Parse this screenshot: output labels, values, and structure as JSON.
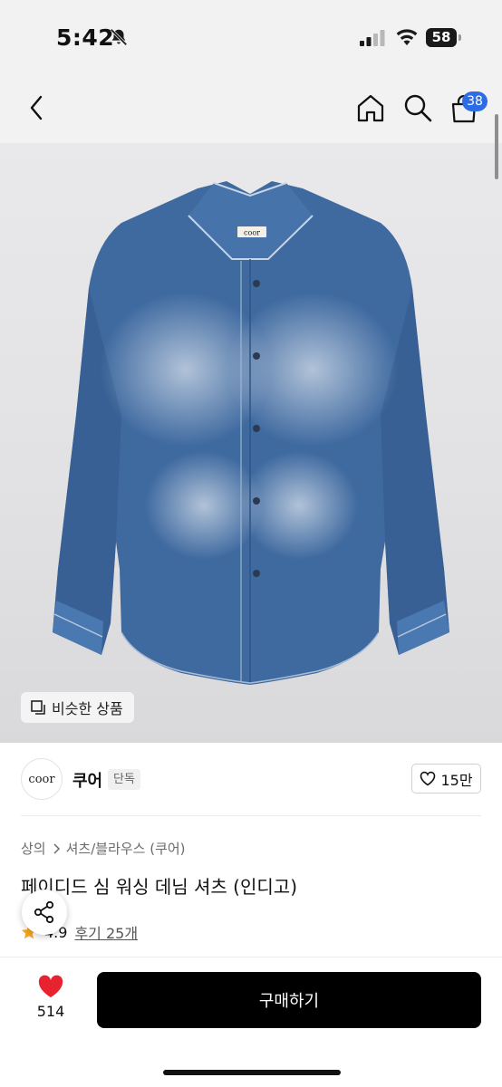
{
  "status_bar": {
    "time": "5:42",
    "battery": "58",
    "icons": [
      "bell-slash-icon",
      "cellular-signal-icon",
      "wifi-icon",
      "battery-icon"
    ]
  },
  "nav": {
    "cart_count": "38",
    "icons": [
      "chevron-left-icon",
      "home-icon",
      "search-icon",
      "shopping-bag-icon"
    ]
  },
  "product_image": {
    "similar_products_label": "비슷한 상품",
    "collar_tag_text": "coor"
  },
  "brand": {
    "logo_text": "coor",
    "name": "쿠어",
    "badge": "단독",
    "like_count": "15만"
  },
  "breadcrumb": {
    "category": "상의",
    "subcategory": "셔츠/블라우스 (쿠어)"
  },
  "product": {
    "title": "페이디드 심 워싱 데님 셔츠 (인디고)",
    "rating": "4.9",
    "review_label": "후기 25개"
  },
  "bottom_bar": {
    "wishlist_count": "514",
    "buy_label": "구매하기"
  },
  "colors": {
    "badge_blue": "#2e6ce6",
    "wishlist_red": "#e8232f",
    "buy_button": "#000000",
    "denim": "#3f6aa0",
    "star": "#f5a623"
  }
}
